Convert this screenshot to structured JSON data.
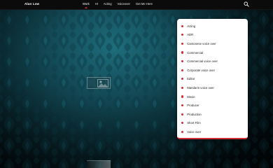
{
  "header": {
    "brand": "Alan Low",
    "nav": [
      {
        "label": "Work",
        "active": true
      },
      {
        "label": "HI"
      },
      {
        "label": "Acting"
      },
      {
        "label": "Voiceover"
      },
      {
        "label": "Get Me Here"
      }
    ],
    "search_icon": "search-icon"
  },
  "dropdown": {
    "items": [
      "Acting",
      "ADR",
      "Cantonese voice over",
      "Commercial",
      "Commercial voice over",
      "Corporate voice over",
      "Editor",
      "Mandarin voice over",
      "Movie",
      "Producer",
      "Production",
      "Short Film",
      "Voice over"
    ],
    "bullet_color": "#d62d33",
    "accent_color": "#d32b32"
  },
  "colors": {
    "background": "#124652",
    "topbar": "#0b0b0b",
    "active_indicator": "#e0343a"
  }
}
